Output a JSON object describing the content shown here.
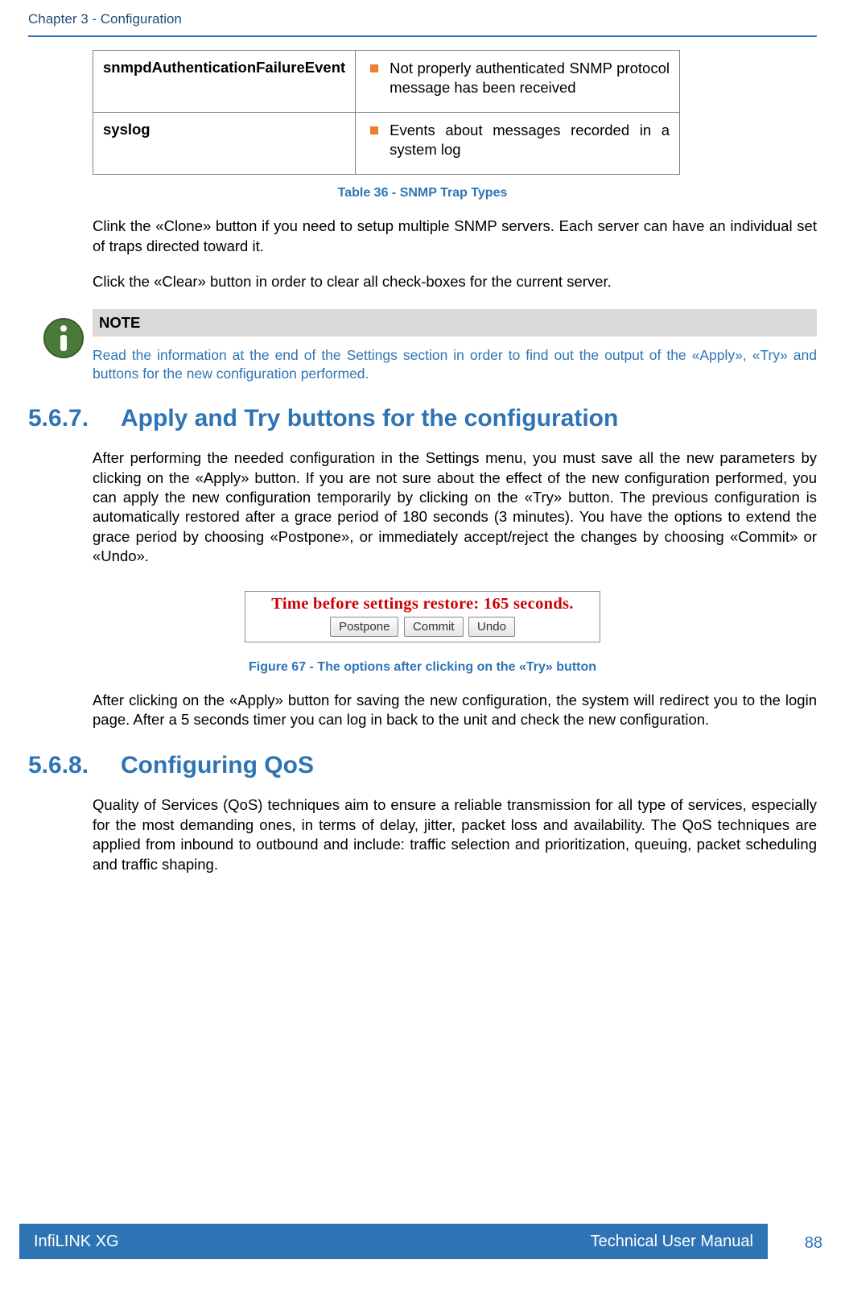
{
  "header": {
    "chapter": "Chapter 3 - Configuration"
  },
  "table": {
    "rows": [
      {
        "name": "snmpdAuthenticationFailureEvent",
        "desc": "Not properly authenticated SNMP protocol message has been received"
      },
      {
        "name": "syslog",
        "desc": "Events about messages recorded in a system log"
      }
    ],
    "caption": "Table 36 - SNMP Trap Types"
  },
  "p1": "Clink the «Clone» button if you need to setup multiple SNMP servers. Each server can have an individual set of traps directed toward it.",
  "p2": "Click the «Clear» button in order to clear all check-boxes for the current server.",
  "note": {
    "head": "NOTE",
    "text": "Read the information at the end of the Settings section in order to find out the output of the «Apply», «Try» and buttons for the new configuration performed."
  },
  "sec567": {
    "num": "5.6.7.",
    "title": "Apply and Try buttons for the configuration",
    "body": "After performing the needed configuration in the Settings menu, you must save all the new parameters by clicking on the «Apply» button. If you are not sure about the effect of the new configuration performed, you can apply the new configuration temporarily by clicking on the «Try» button. The previous configuration is automatically restored after a grace period of 180 seconds (3 minutes). You have the options to extend the grace period by choosing «Postpone», or immediately accept/reject the changes by choosing «Commit» or «Undo»."
  },
  "figure": {
    "title": "Time before settings restore: 165 seconds.",
    "buttons": {
      "postpone": "Postpone",
      "commit": "Commit",
      "undo": "Undo"
    },
    "caption": "Figure 67 - The options after clicking on the «Try» button"
  },
  "p3": "After clicking on the «Apply» button for saving the new configuration, the system will redirect you to the login page. After a 5 seconds timer you can log in back to the unit and check the new configuration.",
  "sec568": {
    "num": "5.6.8.",
    "title": "Configuring QoS",
    "body": "Quality of Services (QoS) techniques aim to ensure a reliable transmission for all type of services, especially for the most demanding ones, in terms of delay, jitter, packet loss and availability. The QoS techniques are applied from inbound to outbound and include: traffic selection and prioritization, queuing, packet scheduling and traffic shaping."
  },
  "footer": {
    "left": "InfiLINK XG",
    "right": "Technical User Manual"
  },
  "pagenum": "88"
}
